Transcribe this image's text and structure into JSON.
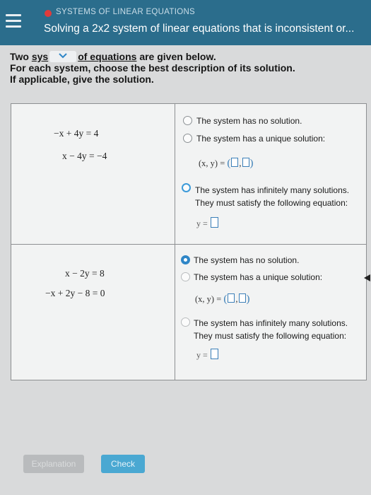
{
  "header": {
    "topic": "SYSTEMS OF LINEAR EQUATIONS",
    "title": "Solving a 2x2 system of linear equations that is inconsistent or..."
  },
  "instructions": {
    "line1_before": "Two ",
    "line1_partial": "sys",
    "line1_after": "of equations",
    "line1_end": " are given below.",
    "line2": "For each system, choose the best description of its solution.",
    "line3": "If applicable, give the solution."
  },
  "system1": {
    "eq1": "−x + 4y  =  4",
    "eq2": "x − 4y  =  −4",
    "options": {
      "no_solution": "The system has no solution.",
      "unique": "The system has a unique solution:",
      "pair_label": "(x, y)  =",
      "infinite_line1": "The system has infinitely many solutions.",
      "infinite_line2": "They must satisfy the following equation:",
      "y_label": "y ="
    }
  },
  "system2": {
    "eq1": "x − 2y  =  8",
    "eq2": "−x + 2y − 8  =  0",
    "options": {
      "no_solution": "The system has no solution.",
      "unique": "The system has a unique solution:",
      "pair_label": "(x, y)  =",
      "infinite_line1": "The system has infinitely many solutions.",
      "infinite_line2": "They must satisfy the following equation:",
      "y_label": "y ="
    },
    "selected": "no_solution"
  },
  "footer": {
    "explanation": "Explanation",
    "check": "Check"
  },
  "colors": {
    "header_bg": "#2b6d8c",
    "accent": "#2f86c7",
    "topic_dot": "#e03b3b"
  },
  "icons": [
    "menu-icon",
    "chevron-down-icon",
    "pointer-arrow-icon"
  ]
}
